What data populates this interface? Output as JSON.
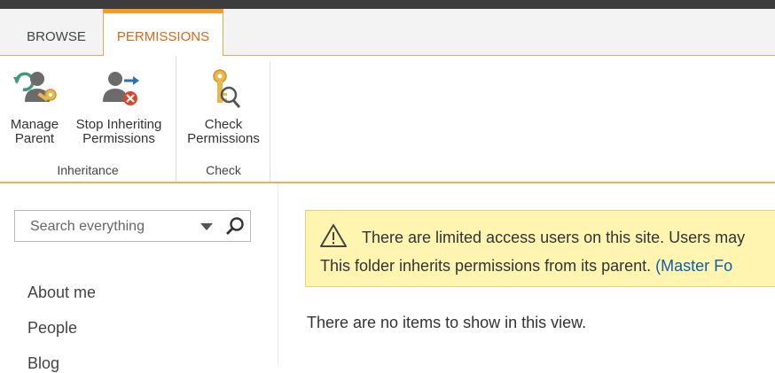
{
  "tabs": [
    {
      "label": "BROWSE"
    },
    {
      "label": "PERMISSIONS",
      "selected": true
    }
  ],
  "ribbon": {
    "groups": [
      {
        "label": "Inheritance",
        "buttons": [
          {
            "label_lines": [
              "Manage",
              "Parent"
            ],
            "icon": "manage-parent-icon"
          },
          {
            "label_lines": [
              "Stop Inheriting",
              "Permissions"
            ],
            "icon": "stop-inheriting-icon"
          }
        ]
      },
      {
        "label": "Check",
        "buttons": [
          {
            "label_lines": [
              "Check",
              "Permissions"
            ],
            "icon": "check-permissions-icon"
          }
        ]
      }
    ]
  },
  "search": {
    "placeholder": "Search everything"
  },
  "nav": {
    "items": [
      "About me",
      "People",
      "Blog"
    ]
  },
  "banner": {
    "line1": "There are limited access users on this site. Users may",
    "line2_text": "This folder inherits permissions from its parent. ",
    "line2_link": "(Master Fo"
  },
  "empty_message": "There are no items to show in this view.",
  "colors": {
    "accent": "#f59b24",
    "tab_text_active": "#d06a1c",
    "banner_bg": "#fff5b1",
    "link": "#0f5fa8"
  }
}
